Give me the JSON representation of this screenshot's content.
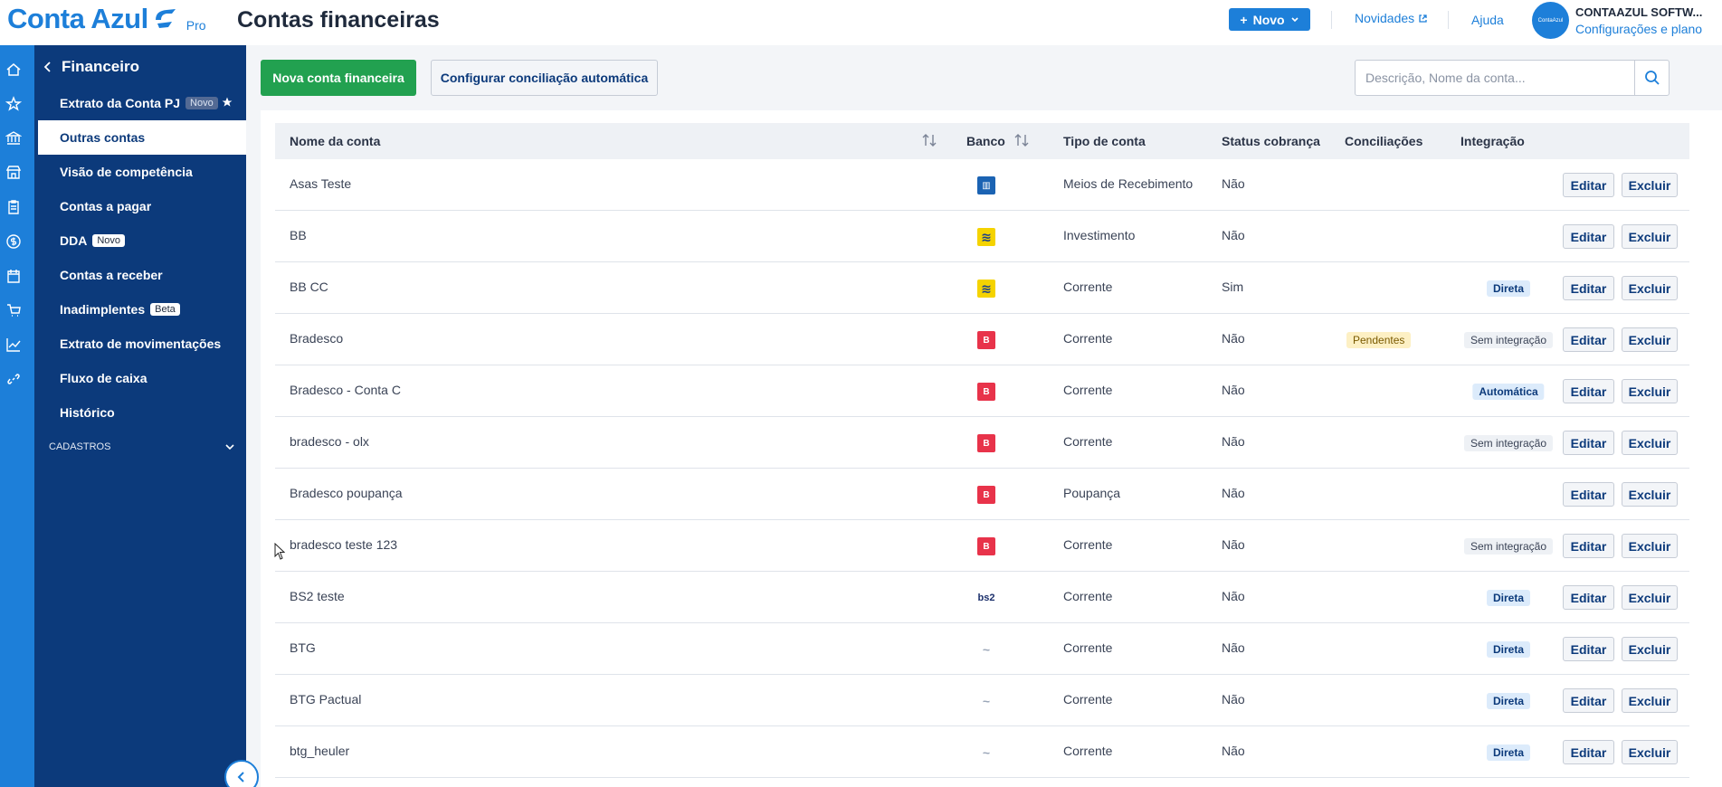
{
  "header": {
    "logo_text": "Conta Azul",
    "logo_plan": "Pro",
    "page_title": "Contas financeiras",
    "novo_label": "Novo",
    "novidades_label": "Novidades",
    "ajuda_label": "Ajuda",
    "avatar_text": "ContaAzul",
    "company_name": "CONTAAZUL SOFTW...",
    "company_sub": "Configurações e plano",
    "brand_color": "#1d7fd9"
  },
  "sidebar": {
    "section_title": "Financeiro",
    "items": [
      {
        "label": "Extrato da Conta PJ",
        "badge": "Novo"
      },
      {
        "label": "Outras contas"
      },
      {
        "label": "Visão de competência"
      },
      {
        "label": "Contas a pagar"
      },
      {
        "label": "DDA",
        "badge": "Novo"
      },
      {
        "label": "Contas a receber"
      },
      {
        "label": "Inadimplentes",
        "badge": "Beta"
      },
      {
        "label": "Extrato de movimentações"
      },
      {
        "label": "Fluxo de caixa"
      },
      {
        "label": "Histórico"
      }
    ],
    "cadastros_label": "CADASTROS",
    "bg_color": "#0c3a7b"
  },
  "toolbar": {
    "new_account_label": "Nova conta financeira",
    "configure_label": "Configurar conciliação automática",
    "search_placeholder": "Descrição, Nome da conta..."
  },
  "table": {
    "headers": {
      "name": "Nome da conta",
      "bank": "Banco",
      "type": "Tipo de conta",
      "status": "Status cobrança",
      "reconciliations": "Conciliações",
      "integration": "Integração"
    },
    "edit_label": "Editar",
    "delete_label": "Excluir",
    "rows": [
      {
        "name": "Asas Teste",
        "bank": "asas",
        "type": "Meios de Recebimento",
        "status": "Não",
        "reconciliation": "",
        "integration": ""
      },
      {
        "name": "BB",
        "bank": "bb",
        "type": "Investimento",
        "status": "Não",
        "reconciliation": "",
        "integration": ""
      },
      {
        "name": "BB CC",
        "bank": "bb",
        "type": "Corrente",
        "status": "Sim",
        "reconciliation": "",
        "integration": "Direta"
      },
      {
        "name": "Bradesco",
        "bank": "bradesco",
        "type": "Corrente",
        "status": "Não",
        "reconciliation": "Pendentes",
        "integration": "Sem integração"
      },
      {
        "name": "Bradesco - Conta C",
        "bank": "bradesco",
        "type": "Corrente",
        "status": "Não",
        "reconciliation": "",
        "integration": "Automática"
      },
      {
        "name": "bradesco - olx",
        "bank": "bradesco",
        "type": "Corrente",
        "status": "Não",
        "reconciliation": "",
        "integration": "Sem integração"
      },
      {
        "name": "Bradesco poupança",
        "bank": "bradesco",
        "type": "Poupança",
        "status": "Não",
        "reconciliation": "",
        "integration": ""
      },
      {
        "name": "bradesco teste 123",
        "bank": "bradesco",
        "type": "Corrente",
        "status": "Não",
        "reconciliation": "",
        "integration": "Sem integração"
      },
      {
        "name": "BS2 teste",
        "bank": "bs2",
        "type": "Corrente",
        "status": "Não",
        "reconciliation": "",
        "integration": "Direta"
      },
      {
        "name": "BTG",
        "bank": "btg",
        "type": "Corrente",
        "status": "Não",
        "reconciliation": "",
        "integration": "Direta"
      },
      {
        "name": "BTG Pactual",
        "bank": "btg",
        "type": "Corrente",
        "status": "Não",
        "reconciliation": "",
        "integration": "Direta"
      },
      {
        "name": "btg_heuler",
        "bank": "btg",
        "type": "Corrente",
        "status": "Não",
        "reconciliation": "",
        "integration": "Direta"
      }
    ],
    "bank_logos": {
      "asas": {
        "text": "▥",
        "bg": "#1b63b3",
        "fg": "#ffffff"
      },
      "bb": {
        "text": "≋",
        "bg": "#f5d300",
        "fg": "#1b3f8a"
      },
      "bradesco": {
        "text": "B",
        "bg": "#e8334a",
        "fg": "#ffffff"
      },
      "bs2": {
        "text": "bs2",
        "bg": "#ffffff",
        "fg": "#1b2f6b"
      },
      "btg": {
        "text": "~",
        "bg": "#ffffff",
        "fg": "#9aa6b8"
      }
    }
  }
}
